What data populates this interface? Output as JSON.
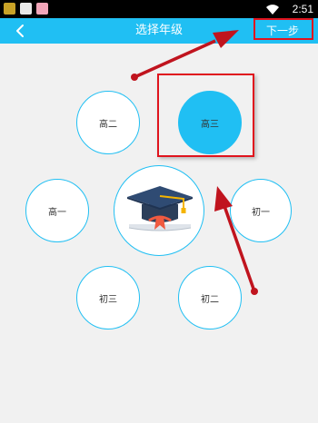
{
  "status_bar": {
    "time": "2:51",
    "icons": [
      "app-notification-icon",
      "panda-icon",
      "pig-icon",
      "wifi-icon"
    ]
  },
  "nav": {
    "back_icon": "chevron-left-icon",
    "title": "选择年级",
    "next_label": "下一步"
  },
  "grades": {
    "gao_er": "高二",
    "gao_san": "高三",
    "gao_yi": "高一",
    "chu_yi": "初一",
    "chu_san": "初三",
    "chu_er": "初二"
  },
  "selected_grade": "高三",
  "center_icon": "graduation-cap-icon",
  "colors": {
    "accent": "#20bff3",
    "highlight": "#e0141e",
    "annotation_arrow": "#c0141e",
    "background": "#f1f1f1"
  }
}
